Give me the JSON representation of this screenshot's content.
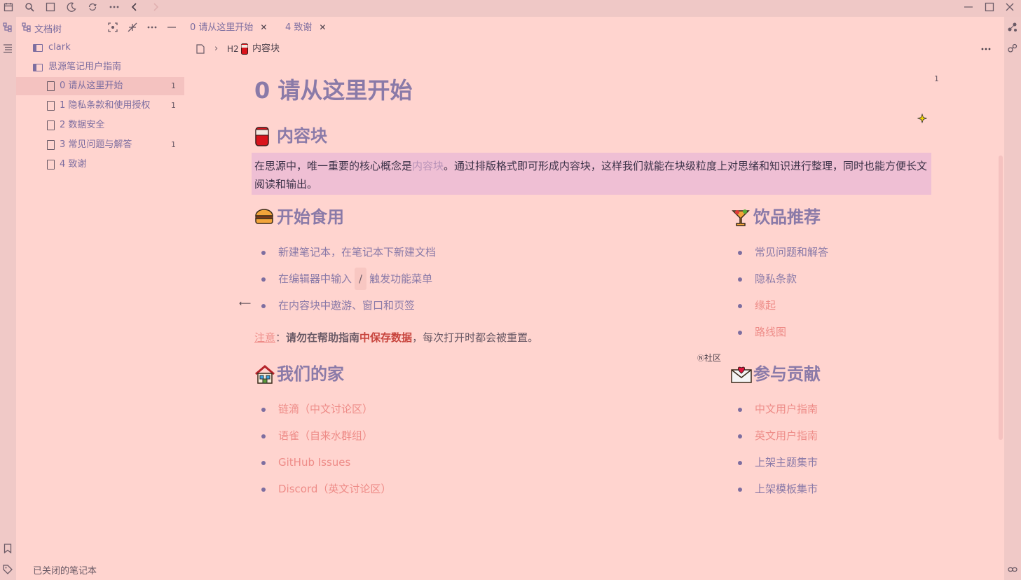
{
  "toolbar": {
    "icons": [
      "calendar-icon",
      "search-icon",
      "square-icon",
      "moon-icon",
      "sync-icon",
      "more-icon",
      "back-icon",
      "forward-icon"
    ],
    "window_controls": [
      "minimize-icon",
      "maximize-icon",
      "close-icon"
    ]
  },
  "tree": {
    "title": "文档树",
    "notebooks": [
      {
        "label": "clark"
      },
      {
        "label": "思源笔记用户指南"
      }
    ],
    "docs": [
      {
        "label": "0 请从这里开始",
        "count": "1"
      },
      {
        "label": "1 隐私条款和使用授权",
        "count": "1"
      },
      {
        "label": "2 数据安全",
        "count": ""
      },
      {
        "label": "3 常见问题与解答",
        "count": "1"
      },
      {
        "label": "4 致谢",
        "count": ""
      }
    ]
  },
  "status": {
    "closed_notebooks": "已关闭的笔记本"
  },
  "tabs": [
    {
      "label": "0 请从这里开始"
    },
    {
      "label": "4 致谢"
    }
  ],
  "breadcrumb": {
    "heading_tag": "H2",
    "current": "内容块"
  },
  "editor": {
    "corner_count": "1",
    "title": "0 请从这里开始",
    "h_content_block": "内容块",
    "para_before": "在思源中，唯一重要的核心概念是",
    "para_ref": "内容块",
    "para_after": "。通过排版格式即可形成内容块，这样我们就能在块级粒度上对思绪和知识进行整理，同时也能方便长文阅读和输出。",
    "h_start": "开始食用",
    "start_items": [
      "新建笔记本，在笔记本下新建文档",
      "在编辑器中输入",
      "/",
      "触发功能菜单",
      "在内容块中遨游、窗口和页签"
    ],
    "note_label": "注意",
    "note_colon": "：",
    "note_bold": "请勿在帮助指南",
    "note_red": "中保存数据",
    "note_rest": "，每次打开时都会被重置。",
    "h_home": "我们的家",
    "home_items": [
      "链滴（中文讨论区）",
      "语雀（自来水群组）",
      "GitHub Issues",
      "Discord（英文讨论区）"
    ],
    "community_badge": "社区",
    "h_drinks": "饮品推荐",
    "drink_items": [
      "常见问题和解答",
      "隐私条款",
      "缘起",
      "路线图"
    ],
    "h_contribute": "参与贡献",
    "contribute_items": [
      "中文用户指南",
      "英文用户指南",
      "上架主题集市",
      "上架模板集市"
    ]
  },
  "colors": {
    "background": "#ffd4cf",
    "heading": "#8a7aa8",
    "link": "#ee8c88",
    "highlight": "#efbfd4"
  }
}
